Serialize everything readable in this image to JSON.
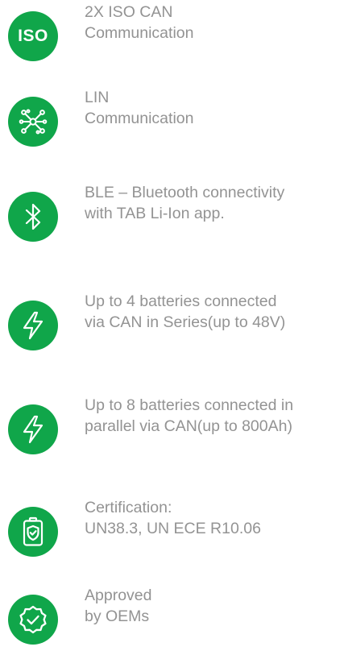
{
  "colors": {
    "accent": "#10a64a",
    "text": "#939393",
    "background": "#ffffff"
  },
  "features": [
    {
      "icon": "iso-icon",
      "icon_text": "ISO",
      "lines": [
        "2X ISO CAN",
        "Communication"
      ]
    },
    {
      "icon": "network-icon",
      "lines": [
        "LIN",
        "Communication"
      ]
    },
    {
      "icon": "bluetooth-icon",
      "lines": [
        "BLE – Bluetooth connectivity",
        "with TAB Li-Ion app."
      ]
    },
    {
      "icon": "lightning-icon",
      "lines": [
        "Up to 4 batteries connected",
        "via CAN in Series(up to 48V)"
      ]
    },
    {
      "icon": "lightning-icon",
      "lines": [
        "Up to 8 batteries connected in",
        "parallel via CAN(up to 800Ah)"
      ]
    },
    {
      "icon": "battery-shield-icon",
      "lines": [
        "Certification:",
        "UN38.3, UN ECE R10.06"
      ]
    },
    {
      "icon": "badge-check-icon",
      "lines": [
        "Approved",
        "by OEMs"
      ]
    }
  ]
}
